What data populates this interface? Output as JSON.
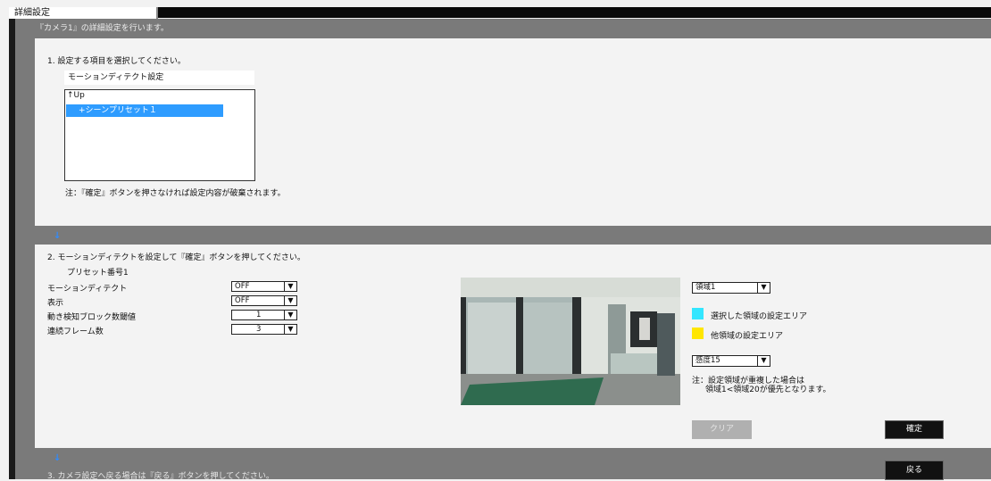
{
  "window": {
    "title": "詳細設定",
    "subtitle": "『カメラ1』の詳細設定を行います。"
  },
  "section1": {
    "heading": "1. 設定する項目を選択してください。",
    "selected_item": "モーションディテクト設定",
    "list": {
      "up_label": "↑Up",
      "selected_entry": "+シーンプリセット１"
    },
    "note": "注：『確定』ボタンを押さなければ設定内容が破棄されます。"
  },
  "section2": {
    "heading": "2. モーションディテクトを設定して『確定』ボタンを押してください。",
    "preset_label": "プリセット番号1",
    "fields": [
      {
        "label": "モーションディテクト",
        "value": "OFF"
      },
      {
        "label": "表示",
        "value": "OFF"
      },
      {
        "label": "動き検知ブロック数閾値",
        "value": "1"
      },
      {
        "label": "連続フレーム数",
        "value": "3"
      }
    ],
    "area_select": "領域1",
    "legend_selected": "選択した領域の設定エリア",
    "legend_other": "他領域の設定エリア",
    "sensitivity_select": "感度15",
    "overlap_note_1": "注：設定領域が重複した場合は",
    "overlap_note_2": "領域1<領域20が優先となります。",
    "clear_button": "クリア",
    "confirm_button": "確定"
  },
  "section3": {
    "heading": "3. カメラ設定へ戻る場合は『戻る』ボタンを押してください。",
    "back_button": "戻る"
  },
  "icons": {
    "arrow": "↓",
    "dropdown": "▼"
  },
  "colors": {
    "selected_area": "#33e6ff",
    "other_area": "#ffe600",
    "selection_highlight": "#2e9cff",
    "arrow": "#2f8cff"
  }
}
